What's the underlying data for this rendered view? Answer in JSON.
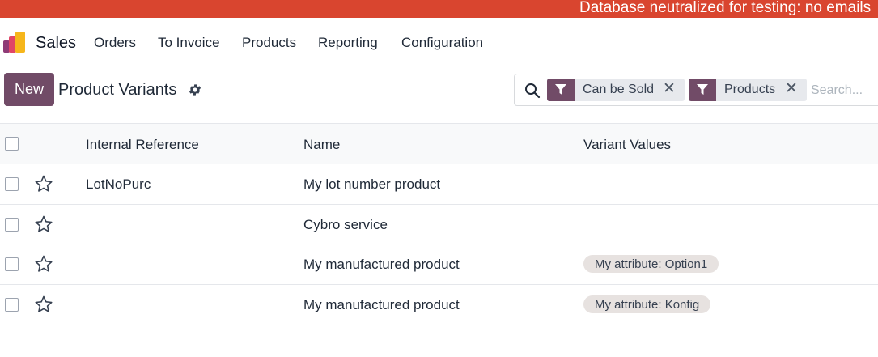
{
  "banner": {
    "text": "Database neutralized for testing: no emails"
  },
  "navbar": {
    "app_name": "Sales",
    "menu": [
      "Orders",
      "To Invoice",
      "Products",
      "Reporting",
      "Configuration"
    ]
  },
  "control_panel": {
    "new_label": "New",
    "title": "Product Variants"
  },
  "search": {
    "facets": [
      "Can be Sold",
      "Products"
    ],
    "placeholder": "Search..."
  },
  "table": {
    "columns": [
      "Internal Reference",
      "Name",
      "Variant Values"
    ],
    "rows": [
      {
        "reference": "LotNoPurc",
        "name": "My lot number product",
        "variant": ""
      },
      {
        "reference": "",
        "name": "Cybro service",
        "variant": ""
      },
      {
        "reference": "",
        "name": "My manufactured product",
        "variant": "My attribute: Option1"
      },
      {
        "reference": "",
        "name": "My manufactured product",
        "variant": "My attribute: Konfig"
      }
    ]
  },
  "colors": {
    "banner": "#d9452f",
    "accent": "#714b67"
  }
}
